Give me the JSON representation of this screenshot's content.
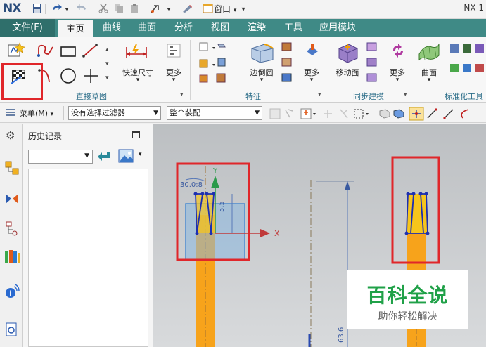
{
  "titlebar": {
    "logo": "NX",
    "window_menu": "窗口",
    "title_right": "NX 1"
  },
  "ribbon_tabs": [
    "文件(F)",
    "主页",
    "曲线",
    "曲面",
    "分析",
    "视图",
    "渲染",
    "工具",
    "应用模块"
  ],
  "ribbon": {
    "groups": {
      "sketch": "直接草图",
      "feature": "特征",
      "sync": "同步建模",
      "standard": "标准化工具 -"
    },
    "buttons": {
      "rapid_dim": "快速尺寸",
      "more1": "更多",
      "edge_blend": "边倒圆",
      "more2": "更多",
      "move_face": "移动面",
      "more3": "更多",
      "surface": "曲面"
    }
  },
  "toolbar2": {
    "menu_label": "菜单(M)",
    "filter_value": "没有选择过滤器",
    "assembly_value": "整个装配"
  },
  "navigator": {
    "title": "历史记录"
  },
  "viewport": {
    "dim_angle": "30.0:8",
    "dim_height": "5.5",
    "axis_x": "X",
    "axis_y": "Y",
    "dim_bottom": "63.6"
  },
  "watermark": {
    "main": "百科全说",
    "sub": "助你轻松解决"
  },
  "colors": {
    "ribbon_tab_bg": "#3f8a86",
    "file_tab_bg": "#2f6f6b",
    "group_label": "#2e6f8a",
    "highlight_box": "#e0262a",
    "part_orange": "#f7a31b",
    "sketch_blue": "#1d2fb0",
    "watermark_green": "#20a148"
  }
}
